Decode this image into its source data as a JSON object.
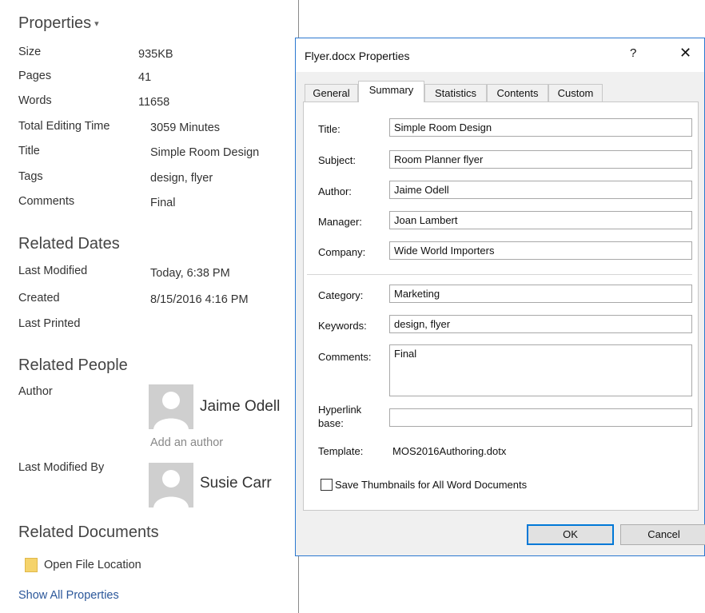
{
  "panel": {
    "properties_heading": "Properties",
    "properties": [
      {
        "label": "Size",
        "value": "935KB"
      },
      {
        "label": "Pages",
        "value": "41"
      },
      {
        "label": "Words",
        "value": "11658"
      },
      {
        "label": "Total Editing Time",
        "value": "3059 Minutes"
      },
      {
        "label": "Title",
        "value": "Simple Room Design"
      },
      {
        "label": "Tags",
        "value": "design, flyer"
      },
      {
        "label": "Comments",
        "value": "Final"
      }
    ],
    "related_dates_heading": "Related Dates",
    "dates": [
      {
        "label": "Last Modified",
        "value": "Today, 6:38 PM"
      },
      {
        "label": "Created",
        "value": "8/15/2016 4:16 PM"
      },
      {
        "label": "Last Printed",
        "value": ""
      }
    ],
    "related_people_heading": "Related People",
    "author_label": "Author",
    "author_name": "Jaime Odell",
    "add_author": "Add an author",
    "last_modified_by_label": "Last Modified By",
    "last_modified_by_name": "Susie Carr",
    "related_documents_heading": "Related Documents",
    "open_file_location": "Open File Location",
    "show_all_properties": "Show All Properties"
  },
  "dialog": {
    "title": "Flyer.docx Properties",
    "help": "?",
    "close": "✕",
    "tabs": [
      "General",
      "Summary",
      "Statistics",
      "Contents",
      "Custom"
    ],
    "active_tab": "Summary",
    "fields": {
      "title_label": "Title:",
      "title_value": "Simple Room Design",
      "subject_label": "Subject:",
      "subject_value": "Room Planner flyer",
      "author_label": "Author:",
      "author_value": "Jaime Odell",
      "manager_label": "Manager:",
      "manager_value": "Joan Lambert",
      "company_label": "Company:",
      "company_value": "Wide World Importers",
      "category_label": "Category:",
      "category_value": "Marketing",
      "keywords_label": "Keywords:",
      "keywords_value": "design, flyer",
      "comments_label": "Comments:",
      "comments_value": "Final",
      "hyperlink_label_1": "Hyperlink",
      "hyperlink_label_2": "base:",
      "hyperlink_value": "",
      "template_label": "Template:",
      "template_value": "MOS2016Authoring.dotx"
    },
    "save_thumbnails_label": "Save Thumbnails for All Word Documents",
    "ok": "OK",
    "cancel": "Cancel"
  }
}
